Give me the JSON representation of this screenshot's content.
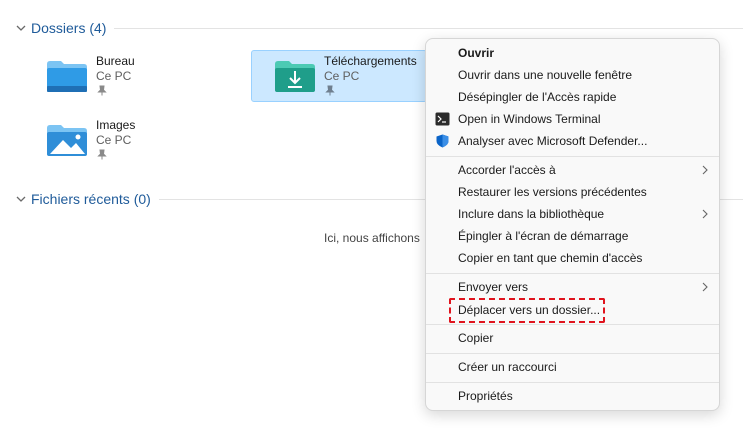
{
  "sections": {
    "folders_title": "Dossiers (4)",
    "recent_title": "Fichiers récents (0)"
  },
  "folders": [
    {
      "name": "Bureau",
      "location": "Ce PC",
      "icon": "desktop-folder-icon",
      "pinned": true
    },
    {
      "name": "Téléchargements",
      "location": "Ce PC",
      "icon": "downloads-folder-icon",
      "pinned": true,
      "selected": true
    },
    {
      "name": "Images",
      "location": "Ce PC",
      "icon": "pictures-folder-icon",
      "pinned": true
    }
  ],
  "recent_empty_text": "Ici, nous affichons",
  "context_menu": {
    "items": [
      {
        "label": "Ouvrir",
        "bold": true
      },
      {
        "label": "Ouvrir dans une nouvelle fenêtre"
      },
      {
        "label": "Désépingler de l'Accès rapide"
      },
      {
        "label": "Open in Windows Terminal",
        "icon": "terminal-icon"
      },
      {
        "label": "Analyser avec Microsoft Defender...",
        "icon": "defender-shield-icon"
      },
      {
        "label": "Accorder l'accès à",
        "submenu": true
      },
      {
        "label": "Restaurer les versions précédentes"
      },
      {
        "label": "Inclure dans la bibliothèque",
        "submenu": true
      },
      {
        "label": "Épingler à l'écran de démarrage"
      },
      {
        "label": "Copier en tant que chemin d'accès"
      },
      {
        "label": "Envoyer vers",
        "submenu": true
      },
      {
        "label": "Déplacer vers un dossier...",
        "highlighted": true
      },
      {
        "label": "Copier"
      },
      {
        "label": "Créer un raccourci"
      },
      {
        "label": "Propriétés"
      }
    ]
  },
  "colors": {
    "section_title": "#1f5b9a",
    "selection_bg": "#cce8ff",
    "highlight_border": "#e0141e",
    "defender_blue": "#0a64c8",
    "downloads_teal": "#1f9e8a",
    "folder_blue": "#2f8ed8"
  }
}
